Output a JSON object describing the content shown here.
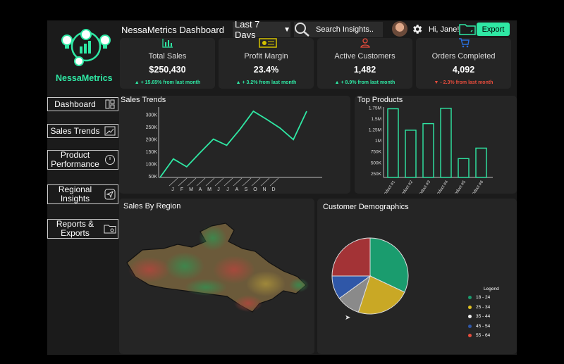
{
  "brand": {
    "name": "NessaMetrics"
  },
  "header": {
    "title": "NessaMetrics Dashboard",
    "date_range": "Last 7 Days",
    "search_placeholder": "Search Insights..",
    "greeting": "Hi, Jane!",
    "export_label": "Export"
  },
  "kpis": [
    {
      "label": "Total Sales",
      "value": "$250,430",
      "change": "+ 15.65% from last month",
      "trend": "up"
    },
    {
      "label": "Profit Margin",
      "value": "23.4%",
      "change": "+ 3.2% from last month",
      "trend": "up"
    },
    {
      "label": "Active Customers",
      "value": "1,482",
      "change": "+ 8.9% from last month",
      "trend": "up"
    },
    {
      "label": "Orders Completed",
      "value": "4,092",
      "change": "- 2.3% from last month",
      "trend": "down"
    }
  ],
  "nav": [
    {
      "label": "Dashboard",
      "icon": "layout-icon"
    },
    {
      "label": "Sales Trends",
      "icon": "bar-chart-icon"
    },
    {
      "label": "Product Performance",
      "icon": "speedometer-icon"
    },
    {
      "label": "Regional Insights",
      "icon": "navigation-icon"
    },
    {
      "label": "Reports & Exports",
      "icon": "folder-gear-icon"
    }
  ],
  "panels": {
    "sales_trends": "Sales Trends",
    "top_products": "Top Products",
    "sales_by_region": "Sales By Region",
    "customer_demographics": "Customer Demographics"
  },
  "colors": {
    "accent": "#2fe8a4",
    "up": "#2fe8a4",
    "down": "#e74c3c",
    "panel": "#252525"
  },
  "chart_data": [
    {
      "type": "line",
      "title": "Sales Trends",
      "categories": [
        "J",
        "F",
        "M",
        "A",
        "M",
        "J",
        "J",
        "A",
        "S",
        "O",
        "N",
        "D"
      ],
      "values": [
        45,
        120,
        88,
        145,
        200,
        175,
        240,
        313,
        280,
        245,
        198,
        313
      ],
      "ylim": [
        45,
        330
      ],
      "yticks": [
        50,
        100,
        150,
        200,
        250,
        300
      ],
      "ytick_labels": [
        "50K",
        "100K",
        "150K",
        "200K",
        "250K",
        "300K"
      ],
      "color": "#2fe8a4"
    },
    {
      "type": "bar",
      "title": "Top Products",
      "categories": [
        "Product #1",
        "Product #2",
        "Product #3",
        "Product #4",
        "Product #5",
        "Product #6"
      ],
      "values": [
        1720,
        1230,
        1380,
        1730,
        580,
        820
      ],
      "ylim": [
        150,
        1760
      ],
      "yticks": [
        250,
        500,
        750,
        1000,
        1250,
        1500,
        1750
      ],
      "ytick_labels": [
        "250K",
        "500K",
        "750K",
        "1M",
        "1.25M",
        "1.5M",
        "1.75M"
      ],
      "color": "#2fe8a4"
    },
    {
      "type": "pie",
      "title": "Customer Demographics",
      "legend_title": "Legend",
      "legend_position": "bottom-right",
      "slices": [
        {
          "label": "18 - 24",
          "value": 32,
          "color": "#1a9c6e"
        },
        {
          "label": "25 - 34",
          "value": 23,
          "color": "#c9a825"
        },
        {
          "label": "35 - 44",
          "value": 10,
          "color": "#8a8a8a"
        },
        {
          "label": "45 - 54",
          "value": 10,
          "color": "#2f57a8"
        },
        {
          "label": "55 - 64",
          "value": 25,
          "color": "#a33336"
        }
      ]
    }
  ]
}
